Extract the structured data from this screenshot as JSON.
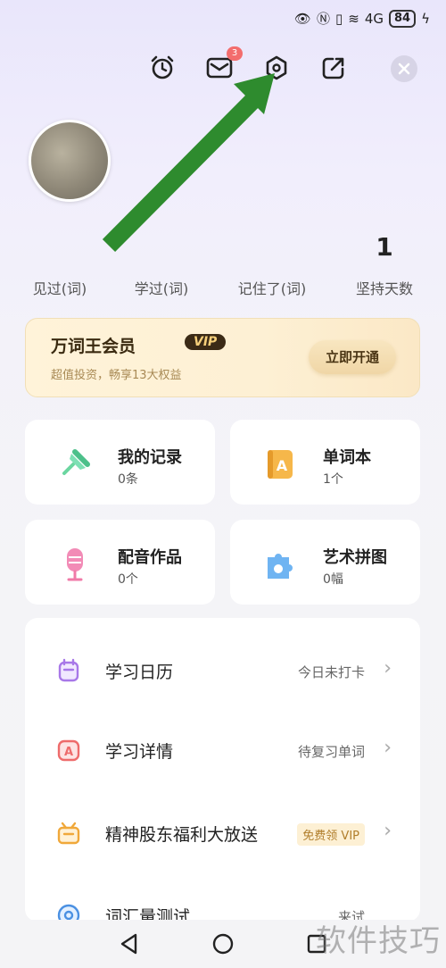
{
  "status_bar": {
    "battery": "84"
  },
  "header": {
    "mail_badge": "3"
  },
  "stats": [
    {
      "value": "",
      "label": "见过(词)"
    },
    {
      "value": "",
      "label": "学过(词)"
    },
    {
      "value": "",
      "label": "记住了(词)"
    },
    {
      "value": "1",
      "label": "坚持天数"
    }
  ],
  "vip": {
    "title": "万词王会员",
    "tag": "VIP",
    "subtitle": "超值投资，畅享13大权益",
    "button": "立即开通"
  },
  "tiles": [
    {
      "title": "我的记录",
      "sub": "0条"
    },
    {
      "title": "单词本",
      "sub": "1个"
    },
    {
      "title": "配音作品",
      "sub": "0个"
    },
    {
      "title": "艺术拼图",
      "sub": "0幅"
    }
  ],
  "list": [
    {
      "title": "学习日历",
      "right": "今日未打卡"
    },
    {
      "title": "学习详情",
      "right": "待复习单词"
    },
    {
      "title": "精神股东福利大放送",
      "right": "免费领 VIP"
    },
    {
      "title": "词汇量测试",
      "right": "来试"
    }
  ],
  "watermark": "软件技巧",
  "colors": {
    "arrow": "#2e8b2e",
    "badge": "#f36d6d",
    "vip_bg": "#fff3d9"
  }
}
